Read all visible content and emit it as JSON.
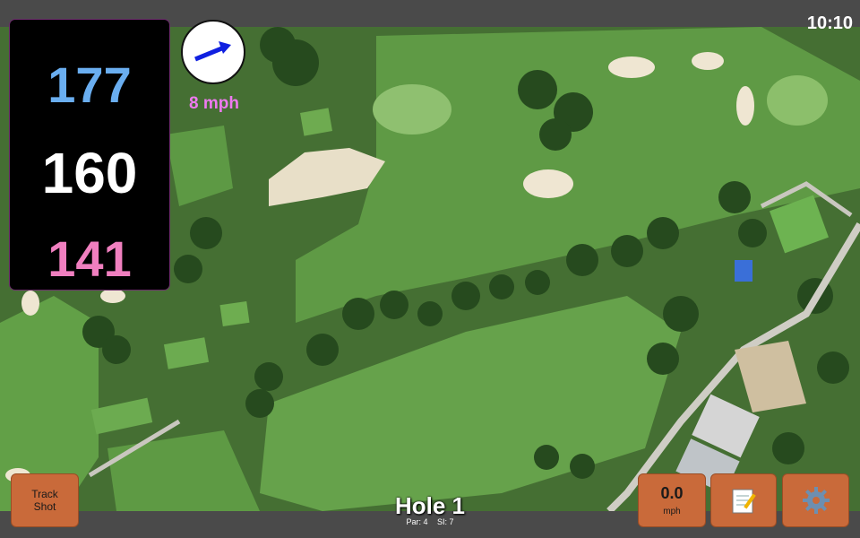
{
  "status": {
    "time": "10:10"
  },
  "distances": {
    "back": "177",
    "middle": "160",
    "front": "141"
  },
  "wind": {
    "speed_label": "8 mph",
    "icon": "wind-arrow-icon"
  },
  "buttons": {
    "track_shot_line1": "Track",
    "track_shot_line2": "Shot",
    "speed_value": "0.0",
    "speed_unit": "mph",
    "notes_icon": "notepad-icon",
    "settings_icon": "gear-icon"
  },
  "hole": {
    "title": "Hole 1",
    "par": "Par: 4",
    "si": "SI: 7"
  },
  "colors": {
    "button": "#c96a3a",
    "back": "#6aaef0",
    "front": "#f07fbf",
    "wind": "#ee7af0"
  }
}
